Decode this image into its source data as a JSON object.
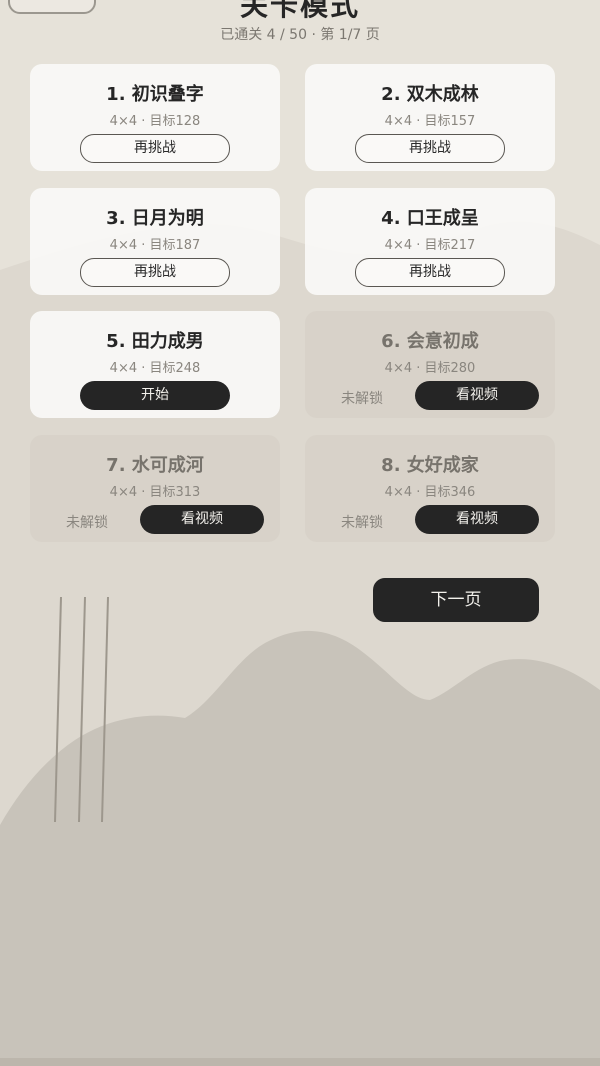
{
  "header": {
    "title": "关卡模式",
    "subtitle": "已通关 4 / 50 · 第 1/7 页"
  },
  "levels": [
    {
      "title": "1. 初识叠字",
      "meta": "4×4 · 目标128",
      "button": "再挑战"
    },
    {
      "title": "2. 双木成林",
      "meta": "4×4 · 目标157",
      "button": "再挑战"
    },
    {
      "title": "3. 日月为明",
      "meta": "4×4 · 目标187",
      "button": "再挑战"
    },
    {
      "title": "4. 口王成呈",
      "meta": "4×4 · 目标217",
      "button": "再挑战"
    },
    {
      "title": "5. 田力成男",
      "meta": "4×4 · 目标248",
      "button": "开始"
    },
    {
      "title": "6. 会意初成",
      "meta": "4×4 · 目标280",
      "locked": "未解锁",
      "button": "看视频"
    },
    {
      "title": "7. 水可成河",
      "meta": "4×4 · 目标313",
      "locked": "未解锁",
      "button": "看视频"
    },
    {
      "title": "8. 女好成家",
      "meta": "4×4 · 目标346",
      "locked": "未解锁",
      "button": "看视频"
    }
  ],
  "next_page_label": "下一页",
  "colors": {
    "background": "#e6e2d9",
    "card": "#faf9f7",
    "card_locked": "#d6d0c7",
    "dark_button": "#252525",
    "mountain_light": "#d9d4ca",
    "mountain_dark": "#c4bfb6"
  },
  "icons": {
    "back": "back-button"
  }
}
